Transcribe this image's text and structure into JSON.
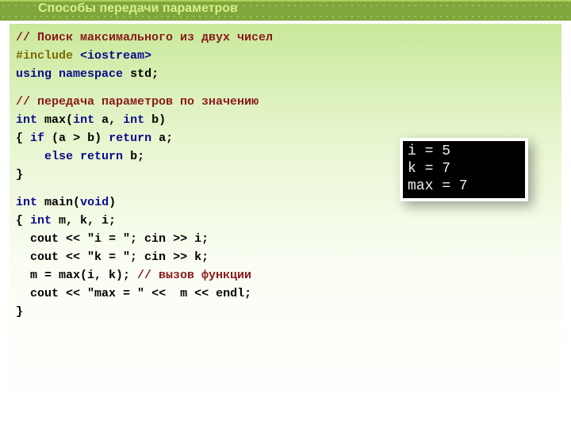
{
  "title": "Способы передачи параметров",
  "code": {
    "c1": "// Поиск максимального из двух чисел",
    "inc_kw": "#include",
    "inc_sp": " ",
    "inc_hdr": "<iostream>",
    "using_kw": "using",
    "ns_kw": "namespace",
    "std_id": "std",
    "semi": ";",
    "c2": "// передача параметров по значению",
    "int_kw": "int",
    "max_id": "max",
    "lp": "(",
    "rp": ")",
    "a_id": "a",
    "b_id": "b",
    "comma": ", ",
    "lb": "{ ",
    "rb": "}",
    "if_kw": "if",
    "gt": " > ",
    "ret_kw": "return",
    "sp": " ",
    "else_kw": "else",
    "main_id": "main",
    "void_kw": "void",
    "decl_rest": " m, k, i;",
    "cout_id": "  cout ",
    "lshift": "<< ",
    "rshift": ">>",
    "str_i": "\"i = \"",
    "str_k": "\"k = \"",
    "str_max": "\"max = \"",
    "cin_id": "; cin ",
    "tail_i": " i;",
    "tail_k": " k;",
    "assign_line_a": "  m = max(i, k); ",
    "assign_comment": "// вызов функции",
    "out_tail": " m << endl;",
    "indent4": "    ",
    "indent_open": "{ ",
    "open_paren_gap": " ("
  },
  "console": {
    "l1": "i = 5",
    "l2": "k = 7",
    "l3": "max = 7"
  }
}
